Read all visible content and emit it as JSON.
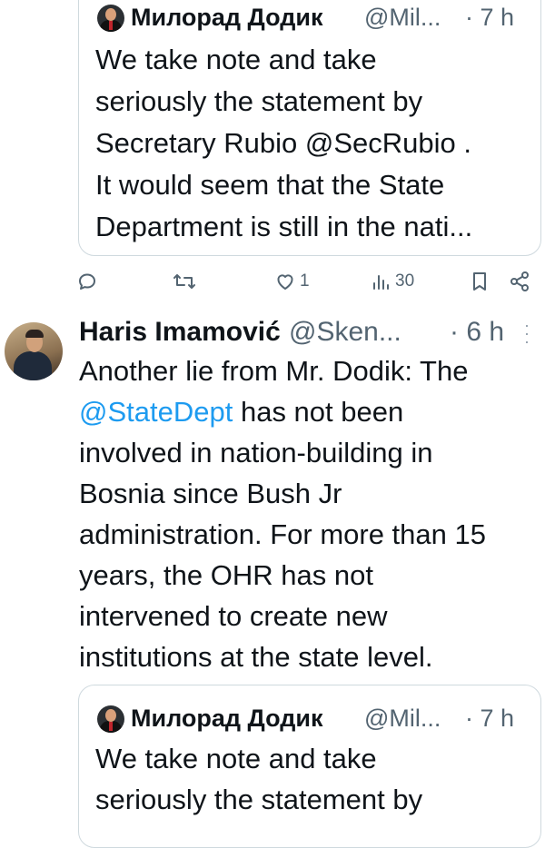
{
  "quoted_tweet": {
    "author_name": "Милорад Додик",
    "handle": "@Mil...",
    "time": "· 7 h",
    "lines": [
      "We take note and take",
      "seriously the statement by",
      "Secretary Rubio @SecRubio .",
      "It would seem that the State",
      "Department is still in the nati..."
    ]
  },
  "actions": {
    "reply_count": "",
    "retweet_count": "",
    "like_count": "1",
    "views_count": "30"
  },
  "tweet": {
    "author_name": "Haris Imamović",
    "handle": "@Sken...",
    "time": "· 6 h",
    "line1": "Another lie from Mr. Dodik: The",
    "mention": "@StateDept",
    "line2_rest": " has not been",
    "lines": [
      "involved in nation-building in",
      "Bosnia since Bush Jr",
      "administration. For more than 15",
      "years, the OHR has not",
      "intervened to create new",
      "institutions at the state level."
    ]
  },
  "quoted_tweet_2": {
    "author_name": "Милорад Додик",
    "handle": "@Mil...",
    "time": "· 7 h",
    "lines": [
      "We take note and take",
      "seriously the statement by"
    ]
  },
  "icons": {
    "reply": "reply-icon",
    "retweet": "retweet-icon",
    "like": "heart-icon",
    "views": "views-icon",
    "bookmark": "bookmark-icon",
    "share": "share-icon",
    "more": "more-icon"
  },
  "colors": {
    "mention": "#1d9bf0",
    "secondary_text": "#536471",
    "border": "#cfd9de"
  }
}
